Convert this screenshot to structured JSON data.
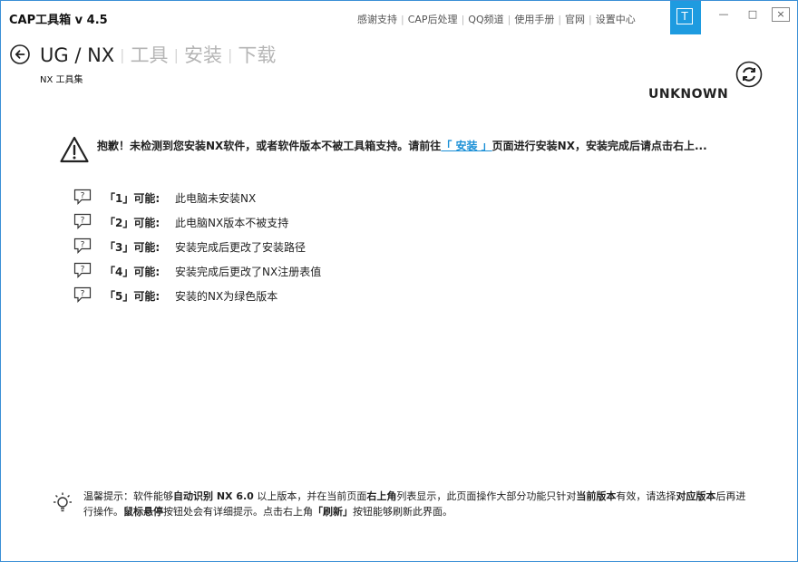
{
  "app": {
    "title": "CAP工具箱 v 4.5"
  },
  "toplinks": [
    "感谢支持",
    "CAP后处理",
    "QQ频道",
    "使用手册",
    "官网",
    "设置中心"
  ],
  "window": {
    "theme_letter": "T",
    "minimize": "—",
    "maximize": "□",
    "close": "×"
  },
  "breadcrumb": {
    "current": "UG / NX",
    "tabs": [
      "工具",
      "安装",
      "下载"
    ]
  },
  "subtitle": "NX 工具集",
  "version": "UNKNOWN",
  "warning": {
    "prefix": "抱歉！未检测到您安装NX软件，或者软件版本不被工具箱支持。请前往",
    "link": "「 安装 」",
    "suffix": "页面进行安装NX，安装完成后请点击右上..."
  },
  "reasons": [
    {
      "num": "「1」可能:",
      "text": "此电脑未安装NX"
    },
    {
      "num": "「2」可能:",
      "text": "此电脑NX版本不被支持"
    },
    {
      "num": "「3」可能:",
      "text": "安装完成后更改了安装路径"
    },
    {
      "num": "「4」可能:",
      "text": "安装完成后更改了NX注册表值"
    },
    {
      "num": "「5」可能:",
      "text": "安装的NX为绿色版本"
    }
  ],
  "tip": {
    "p1": "温馨提示：软件能够",
    "b1": "自动识别 NX 6.0",
    "p2": " 以上版本，并在当前页面",
    "b2": "右上角",
    "p3": "列表显示，此页面操作大部分功能只针对",
    "b3": "当前版本",
    "p4": "有效，请选择",
    "b4": "对应版本",
    "p5": "后再进行操作。",
    "b5": "鼠标悬停",
    "p6": "按钮处会有详细提示。点击右上角",
    "b6": "「刷新」",
    "p7": "按钮能够刷新此界面。"
  },
  "colors": {
    "accent": "#1e9be0",
    "link": "#1a8fd6"
  }
}
